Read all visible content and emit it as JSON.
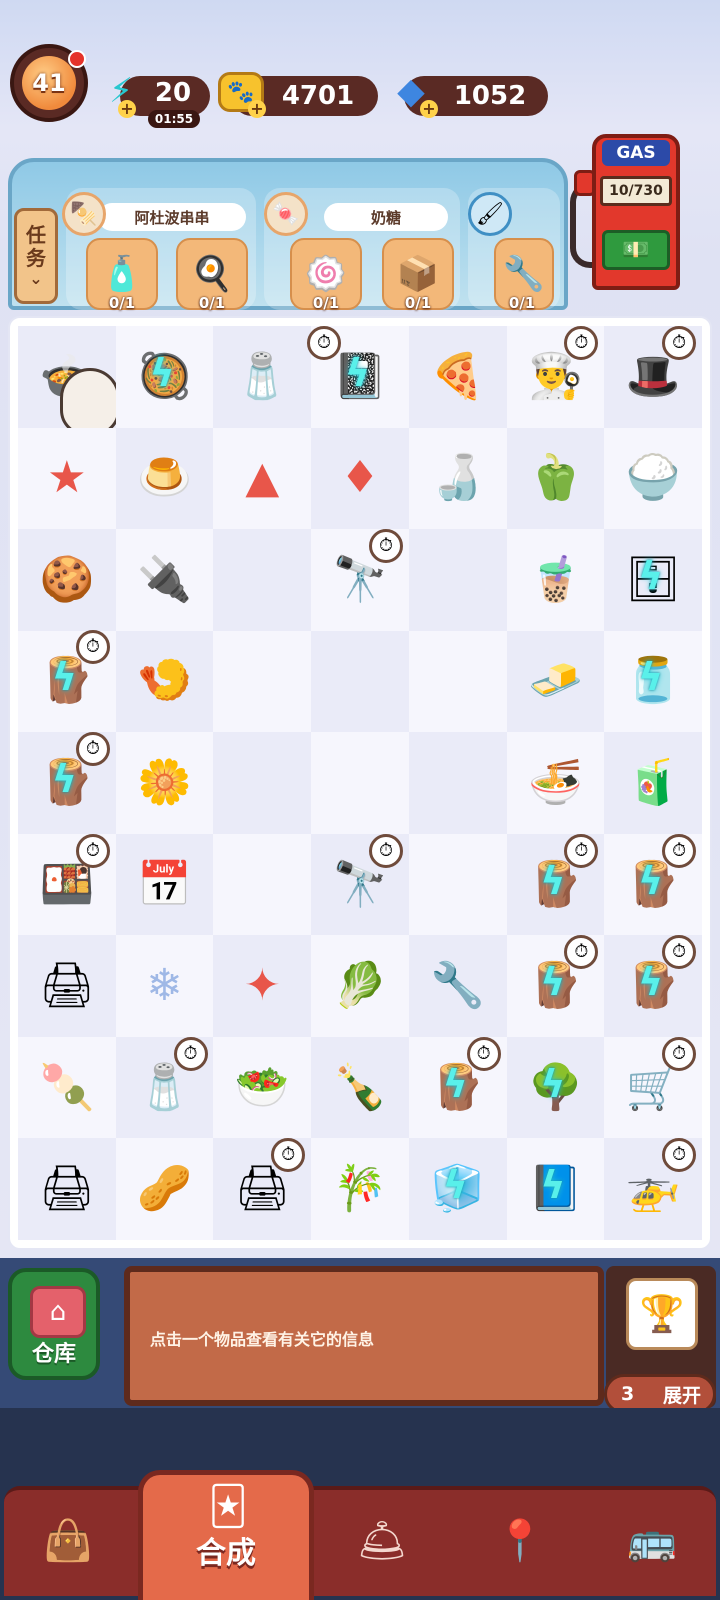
{
  "status": {
    "level": "41",
    "energy": "20",
    "energy_timer": "01:55",
    "paws": "4701",
    "gems": "1052",
    "energy_icon": "lightning-icon",
    "paw_icon": "paw-coin-icon",
    "gem_icon": "diamond-icon"
  },
  "tasks_tab": {
    "line1": "任",
    "line2": "务",
    "arrow": "⌄"
  },
  "orders": [
    {
      "customer": "阿杜波串串",
      "items": [
        {
          "icon": "sauce-bottle-icon",
          "count": "0/1"
        },
        {
          "icon": "fried-egg-icon",
          "count": "0/1"
        }
      ]
    },
    {
      "customer": "奶糖",
      "items": [
        {
          "icon": "fish-cake-icon",
          "count": "0/1"
        },
        {
          "icon": "takeout-box-icon",
          "count": "0/1"
        }
      ]
    },
    {
      "customer": "",
      "items": [
        {
          "icon": "drill-icon",
          "count": "0/1"
        }
      ]
    }
  ],
  "gas": {
    "label": "GAS",
    "level": "10/730"
  },
  "info": {
    "message": "点击一个物品查看有关它的信息"
  },
  "warehouse": {
    "label": "仓库"
  },
  "expand": {
    "count": "3",
    "label": "展开"
  },
  "nav": {
    "active_label": "合成",
    "tabs": [
      "bag-icon",
      "merge-icon",
      "cloche-icon",
      "map-pin-icon",
      "bus-icon"
    ]
  },
  "colors": {
    "accent": "#e46a4a",
    "energy_bolt": "#59f0ea",
    "panel": "#8fc9e6",
    "info_board": "#c26a48"
  }
}
